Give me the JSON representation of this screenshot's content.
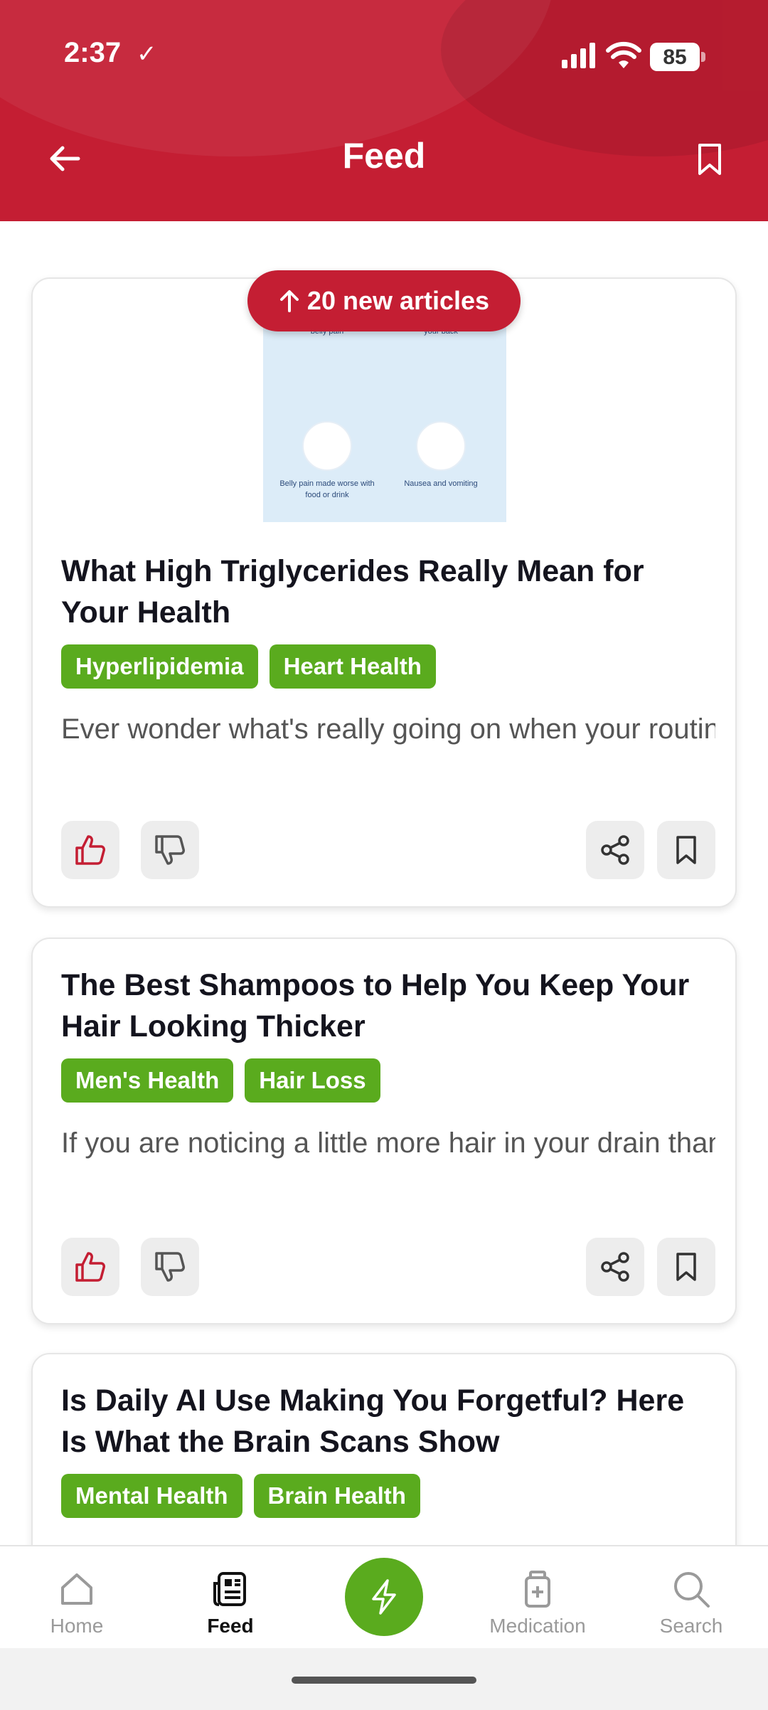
{
  "status_bar": {
    "time": "2:37",
    "battery": "85"
  },
  "header": {
    "title": "Feed"
  },
  "new_articles": {
    "label": "20 new articles"
  },
  "articles": [
    {
      "image_captions": [
        "Severe and constant upper belly pain",
        "Belly pain that spreads to your back",
        "Belly pain made worse with food or drink",
        "Nausea and vomiting"
      ],
      "title": "What High Triglycerides Really Mean for Your Health",
      "tags": [
        "Hyperlipidemia",
        "Heart Health"
      ],
      "excerpt": "Ever wonder what's really going on when your routine lab work flags sky-high triglycerides ..."
    },
    {
      "title": "The Best Shampoos to Help You Keep Your Hair Looking Thicker",
      "tags": [
        "Men's Health",
        "Hair Loss"
      ],
      "excerpt": "If you are noticing a little more hair in your drain than usual, you are definitely not alone...."
    },
    {
      "title": "Is Daily AI Use Making You Forgetful? Here Is What the Brain Scans Show",
      "tags": [
        "Mental Health",
        "Brain Health"
      ]
    }
  ],
  "bottom_nav": {
    "items": [
      {
        "label": "Home",
        "icon": "home-icon"
      },
      {
        "label": "Feed",
        "icon": "feed-icon",
        "active": true
      },
      {
        "label": "Medication",
        "icon": "medication-icon"
      },
      {
        "label": "Search",
        "icon": "search-icon"
      }
    ],
    "center_icon": "lightning-icon"
  },
  "colors": {
    "brand_red": "#c41e33",
    "tag_green": "#5aab1e",
    "like_red": "#c41e33"
  }
}
